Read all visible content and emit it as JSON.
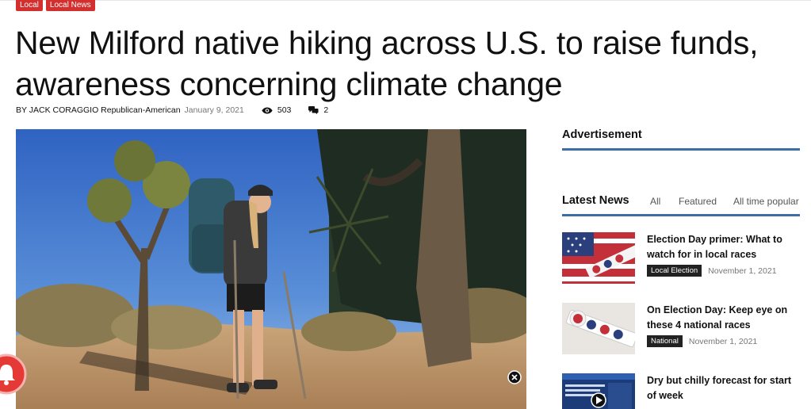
{
  "categories": [
    "Local",
    "Local News"
  ],
  "article": {
    "title": "New Milford native hiking across U.S. to raise funds, awareness concerning climate change",
    "author": "BY JACK CORAGGIO Republican-American",
    "date": "January 9, 2021",
    "views": "503",
    "comments": "2"
  },
  "sidebar": {
    "advertisement_label": "Advertisement",
    "latest_news": {
      "title": "Latest News",
      "tabs": [
        "All",
        "Featured",
        "All time popular"
      ],
      "items": [
        {
          "headline": "Election Day primer: What to watch for in local races",
          "category": "Local Election",
          "date": "November 1, 2021"
        },
        {
          "headline": "On Election Day: Keep eye on these 4 national races",
          "category": "National",
          "date": "November 1, 2021"
        },
        {
          "headline": "Dry but chilly forecast for start of week",
          "category": "",
          "date": ""
        }
      ]
    }
  },
  "colors": {
    "category_red": "#d32f2f",
    "accent_blue": "#3a6ea5",
    "dark_tag": "#222222"
  },
  "icons": [
    "eye-icon",
    "comment-icon",
    "close-icon",
    "notification-bell-icon"
  ]
}
